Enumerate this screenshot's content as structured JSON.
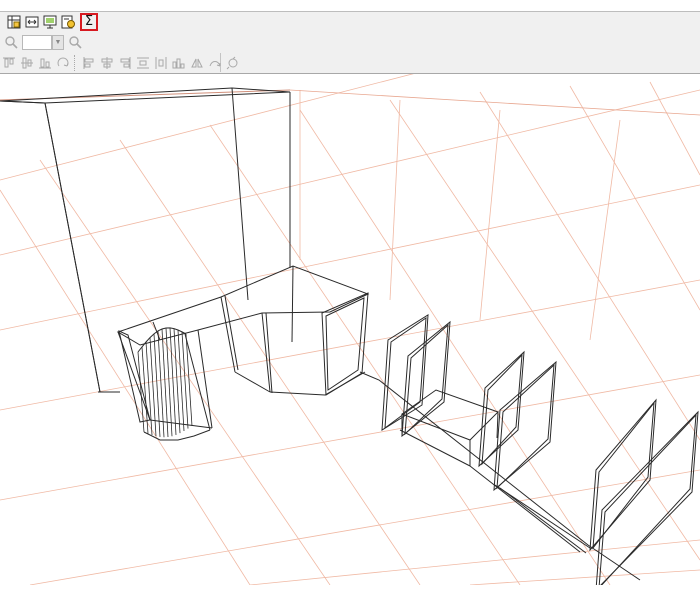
{
  "toolbar": {
    "row1": [
      {
        "icon": "insert-table-icon"
      },
      {
        "icon": "fit-width-icon"
      },
      {
        "icon": "screen-display-icon"
      },
      {
        "icon": "properties-icon"
      }
    ],
    "sigma_button": {
      "label": "Σ",
      "state": "highlighted",
      "highlight_color": "#d71920"
    },
    "zoom": {
      "value": "",
      "placeholder": ""
    },
    "row3_left": [
      "align-top-icon",
      "align-middle-icon",
      "align-bottom-icon",
      "rotate-icon"
    ],
    "row3_right": [
      "align-left-icon",
      "align-center-icon",
      "align-right-icon",
      "distribute-icon",
      "distribute-vertical-icon",
      "spacing-icon",
      "flip-icon",
      "mirror-icon",
      "grid-snap-icon"
    ]
  },
  "viewport": {
    "grid_color": "#f0b9a4",
    "wire_color": "#2a2a2a",
    "grid": "on"
  }
}
